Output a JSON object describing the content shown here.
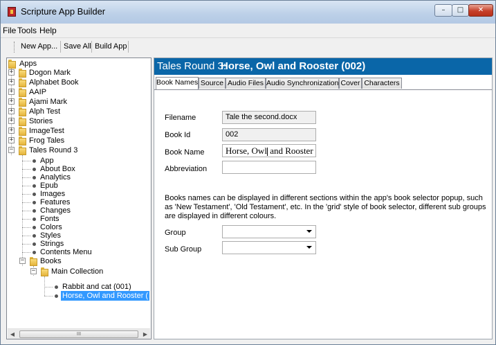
{
  "window": {
    "title": "Scripture App Builder"
  },
  "window_controls": {
    "minimize": "–",
    "maximize": "□",
    "close": "✕"
  },
  "menu": [
    "File",
    "Tools",
    "Help"
  ],
  "toolbar": {
    "new_app": "New App...",
    "save_all": "Save All",
    "build_app": "Build App"
  },
  "tree": {
    "root": "Apps",
    "apps": [
      "Dogon Mark",
      "Alphabet Book",
      "AAIP",
      "Ajami Mark",
      "Alph Test",
      "Stories",
      "ImageTest",
      "Frog Tales",
      "Tales Round 3"
    ],
    "expanded_app_children": [
      "App",
      "About Box",
      "Analytics",
      "Epub",
      "Images",
      "Features",
      "Changes",
      "Fonts",
      "Colors",
      "Styles",
      "Strings",
      "Contents Menu"
    ],
    "books_folder": "Books",
    "collection": "Main Collection",
    "books": [
      "Rabbit and cat (001)",
      "Horse, Owl and Rooster ("
    ],
    "scroll_grip": "III"
  },
  "header": {
    "prefix": "Tales Round 3:",
    "name": "Horse, Owl and Rooster  (002)"
  },
  "tabs": [
    "Book Names",
    "Source",
    "Audio Files",
    "Audio Synchronization",
    "Cover",
    "Characters"
  ],
  "form": {
    "filename_label": "Filename",
    "filename_value": "Tale the second.docx",
    "book_id_label": "Book Id",
    "book_id_value": "002",
    "book_name_label": "Book Name",
    "book_name_before_caret": "Horse, Owl",
    "book_name_after_caret": "and Rooster",
    "abbreviation_label": "Abbreviation",
    "abbreviation_value": "",
    "description": "Books names can be displayed in different sections within the app's book selector popup, such as 'New Testament', 'Old Testament', etc. In the 'grid' style of book selector, different sub groups are displayed in different colours.",
    "group_label": "Group",
    "group_value": "",
    "subgroup_label": "Sub Group",
    "subgroup_value": ""
  },
  "colors": {
    "header_bg": "#0a66a8",
    "selection": "#3399ff",
    "close_button": "#c6402b"
  }
}
